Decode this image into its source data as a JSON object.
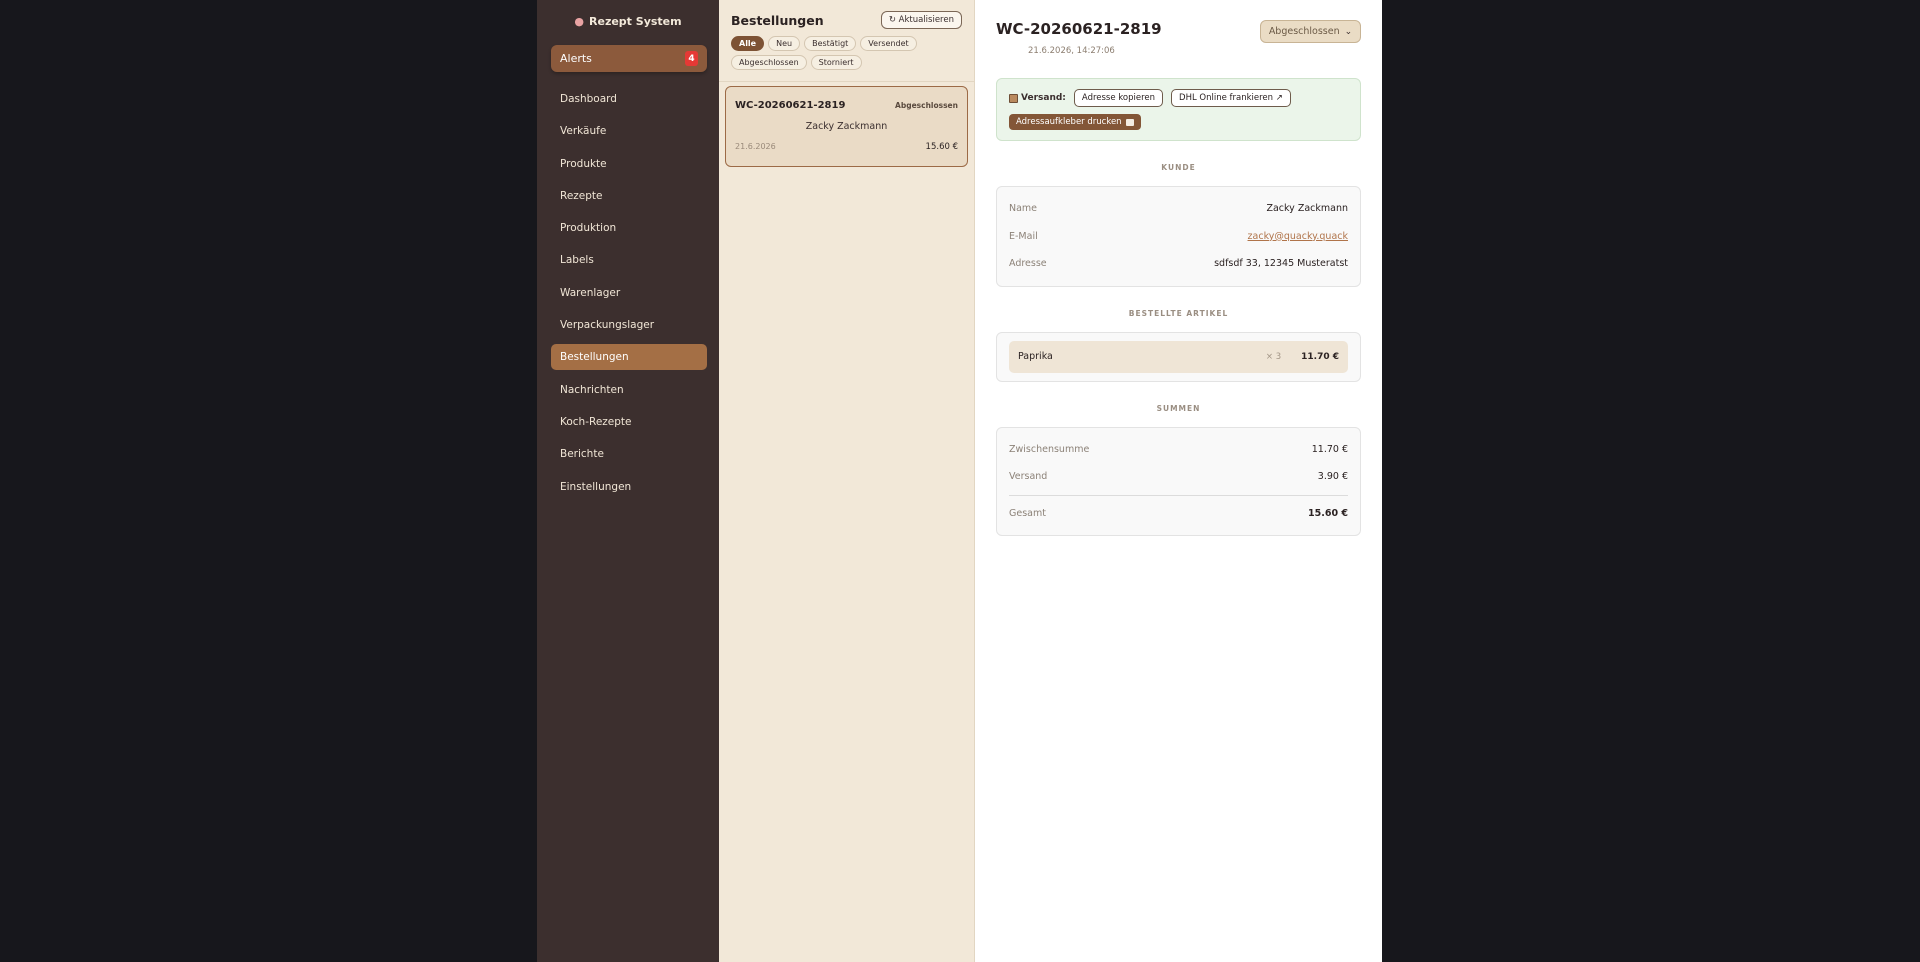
{
  "sidebar": {
    "brand": "Rezept System",
    "brand_icon": "brain-icon",
    "alerts": {
      "label": "Alerts",
      "count": "4"
    },
    "items": [
      {
        "label": "Dashboard"
      },
      {
        "label": "Verkäufe"
      },
      {
        "label": "Produkte"
      },
      {
        "label": "Rezepte"
      },
      {
        "label": "Produktion"
      },
      {
        "label": "Labels"
      },
      {
        "label": "Warenlager"
      },
      {
        "label": "Verpackungslager"
      },
      {
        "label": "Bestellungen",
        "active": true
      },
      {
        "label": "Nachrichten"
      },
      {
        "label": "Koch-Rezepte"
      },
      {
        "label": "Berichte"
      },
      {
        "label": "Einstellungen"
      }
    ]
  },
  "orders": {
    "title": "Bestellungen",
    "refresh_label": "↻ Aktualisieren",
    "filters": [
      "Alle",
      "Neu",
      "Bestätigt",
      "Versendet",
      "Abgeschlossen",
      "Storniert"
    ],
    "active_filter": "Alle",
    "list": [
      {
        "id": "WC-20260621-2819",
        "status": "Abgeschlossen",
        "customer": "Zacky Zackmann",
        "date": "21.6.2026",
        "total": "15.60 €"
      }
    ]
  },
  "detail": {
    "order_id": "WC-20260621-2819",
    "datetime": "21.6.2026, 14:27:06",
    "status_value": "Abgeschlossen",
    "shipping": {
      "label": "Versand:",
      "icon": "package-icon",
      "copy_address": "Adresse kopieren",
      "dhl": "DHL Online frankieren ↗",
      "print": "Adressaufkleber drucken"
    },
    "customer_heading": "KUNDE",
    "customer": {
      "name_label": "Name",
      "name": "Zacky Zackmann",
      "email_label": "E-Mail",
      "email": "zacky@quacky.quack",
      "address_label": "Adresse",
      "address": "sdfsdf 33, 12345 Musteratst"
    },
    "items_heading": "BESTELLTE ARTIKEL",
    "items": [
      {
        "name": "Paprika",
        "qty": "× 3",
        "price": "11.70 €"
      }
    ],
    "sums_heading": "SUMMEN",
    "sums": {
      "subtotal_label": "Zwischensumme",
      "subtotal": "11.70 €",
      "shipping_label": "Versand",
      "shipping": "3.90 €",
      "total_label": "Gesamt",
      "total": "15.60 €"
    }
  },
  "colors": {
    "sidebar_bg": "#3c2f2e",
    "accent": "#a46f45",
    "list_bg": "#f2e8d8",
    "alert_badge": "#e53935"
  }
}
